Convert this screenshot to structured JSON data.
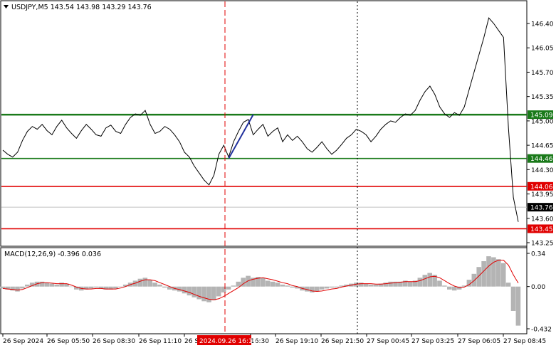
{
  "chart_data": [
    {
      "type": "line",
      "title": "USDJPY,M5  143.54 143.98 143.29 143.76",
      "symbol": "USDJPY,M5",
      "ohlc": {
        "open": 143.54,
        "high": 143.98,
        "low": 143.29,
        "close": 143.76
      },
      "ylim": [
        143.25,
        146.6
      ],
      "y_ticks": [
        "146.40",
        "146.05",
        "145.70",
        "145.35",
        "145.00",
        "144.65",
        "144.30",
        "143.95",
        "143.60",
        "143.25"
      ],
      "x_ticks": [
        "26 Sep 2024",
        "26 Sep 05:50",
        "26 Sep 08:30",
        "26 Sep 11:10",
        "26 S",
        "16:30",
        "26 Sep 19:10",
        "26 Sep 21:50",
        "27 Sep 00:45",
        "27 Sep 03:25",
        "27 Sep 06:05",
        "27 Sep 08:45"
      ],
      "cursor_label": "2024.09.26 16:10",
      "grid": false,
      "series": [
        {
          "name": "",
          "color": "#000000",
          "values": [
            144.58,
            144.52,
            144.48,
            144.55,
            144.72,
            144.85,
            144.92,
            144.88,
            144.95,
            144.86,
            144.8,
            144.92,
            145.01,
            144.9,
            144.82,
            144.75,
            144.86,
            144.95,
            144.88,
            144.8,
            144.78,
            144.9,
            144.94,
            144.85,
            144.82,
            144.95,
            145.05,
            145.1,
            145.08,
            145.15,
            144.95,
            144.82,
            144.85,
            144.92,
            144.88,
            144.8,
            144.7,
            144.55,
            144.48,
            144.35,
            144.25,
            144.15,
            144.08,
            144.22,
            144.52,
            144.65,
            144.48,
            144.7,
            144.85,
            144.98,
            145.02,
            144.8,
            144.88,
            144.95,
            144.78,
            144.85,
            144.9,
            144.7,
            144.8,
            144.72,
            144.78,
            144.7,
            144.6,
            144.55,
            144.62,
            144.7,
            144.6,
            144.52,
            144.58,
            144.66,
            144.75,
            144.8,
            144.88,
            144.85,
            144.8,
            144.7,
            144.78,
            144.88,
            144.95,
            145.0,
            144.98,
            145.05,
            145.1,
            145.08,
            145.15,
            145.3,
            145.42,
            145.5,
            145.38,
            145.2,
            145.1,
            145.05,
            145.12,
            145.08,
            145.2,
            145.45,
            145.7,
            145.95,
            146.2,
            146.48,
            146.4,
            146.3,
            146.2,
            144.9,
            143.9,
            143.55
          ]
        }
      ],
      "h_levels": [
        {
          "value": 145.09,
          "label": "145.09",
          "color": "#1a7a1a"
        },
        {
          "value": 144.46,
          "label": "144.46",
          "color": "#1a7a1a"
        },
        {
          "value": 144.06,
          "label": "144.06",
          "color": "#e00000"
        },
        {
          "value": 143.45,
          "label": "143.45",
          "color": "#e00000"
        }
      ],
      "current_price": {
        "value": 143.76,
        "label": "143.76"
      },
      "annotation_arrow": {
        "from": {
          "x_index": 46,
          "y": 144.46
        },
        "to": {
          "x_index": 51,
          "y": 145.09
        },
        "color": "#1f2f9c"
      }
    },
    {
      "type": "bar",
      "title": "MACD(12,26,9) -0.396 0.036",
      "ylim": [
        -0.432,
        0.34
      ],
      "y_ticks": [
        "0.34",
        "0.00",
        "-0.432"
      ],
      "series": [
        {
          "name": "",
          "color": "#b4b4b4",
          "values": [
            -0.02,
            -0.03,
            -0.04,
            -0.05,
            -0.02,
            0.02,
            0.04,
            0.05,
            0.05,
            0.04,
            0.03,
            0.02,
            0.04,
            0.03,
            0.0,
            -0.03,
            -0.04,
            -0.03,
            -0.02,
            -0.01,
            -0.02,
            -0.03,
            -0.03,
            -0.02,
            0.0,
            0.02,
            0.04,
            0.06,
            0.08,
            0.09,
            0.07,
            0.04,
            0.02,
            -0.01,
            -0.03,
            -0.04,
            -0.05,
            -0.07,
            -0.09,
            -0.11,
            -0.13,
            -0.15,
            -0.16,
            -0.14,
            -0.1,
            -0.06,
            -0.03,
            0.01,
            0.05,
            0.09,
            0.11,
            0.09,
            0.1,
            0.09,
            0.06,
            0.05,
            0.04,
            0.02,
            0.01,
            -0.01,
            -0.02,
            -0.04,
            -0.05,
            -0.06,
            -0.05,
            -0.03,
            -0.02,
            -0.01,
            -0.01,
            0.01,
            0.02,
            0.03,
            0.04,
            0.04,
            0.03,
            0.02,
            0.02,
            0.03,
            0.04,
            0.05,
            0.05,
            0.05,
            0.06,
            0.05,
            0.06,
            0.09,
            0.12,
            0.14,
            0.12,
            0.06,
            0.01,
            -0.03,
            -0.04,
            -0.03,
            0.01,
            0.07,
            0.13,
            0.2,
            0.26,
            0.31,
            0.3,
            0.28,
            0.24,
            0.04,
            -0.25,
            -0.4
          ]
        },
        {
          "name": "",
          "color": "#e00000",
          "values": [
            -0.02,
            -0.025,
            -0.03,
            -0.035,
            -0.03,
            -0.01,
            0.01,
            0.03,
            0.04,
            0.04,
            0.035,
            0.03,
            0.03,
            0.03,
            0.015,
            -0.005,
            -0.02,
            -0.025,
            -0.025,
            -0.02,
            -0.02,
            -0.025,
            -0.025,
            -0.025,
            -0.015,
            0.0,
            0.02,
            0.035,
            0.055,
            0.07,
            0.07,
            0.06,
            0.04,
            0.02,
            0.0,
            -0.02,
            -0.03,
            -0.045,
            -0.06,
            -0.08,
            -0.1,
            -0.115,
            -0.13,
            -0.135,
            -0.125,
            -0.1,
            -0.07,
            -0.04,
            -0.01,
            0.03,
            0.06,
            0.075,
            0.085,
            0.09,
            0.08,
            0.07,
            0.055,
            0.04,
            0.03,
            0.01,
            0.0,
            -0.02,
            -0.03,
            -0.045,
            -0.05,
            -0.045,
            -0.035,
            -0.025,
            -0.02,
            -0.005,
            0.005,
            0.015,
            0.025,
            0.03,
            0.03,
            0.03,
            0.025,
            0.025,
            0.03,
            0.035,
            0.04,
            0.045,
            0.05,
            0.05,
            0.05,
            0.06,
            0.08,
            0.1,
            0.105,
            0.09,
            0.06,
            0.03,
            0.005,
            -0.01,
            -0.005,
            0.02,
            0.06,
            0.11,
            0.16,
            0.21,
            0.25,
            0.27,
            0.27,
            0.22,
            0.12,
            0.036
          ]
        }
      ]
    }
  ]
}
